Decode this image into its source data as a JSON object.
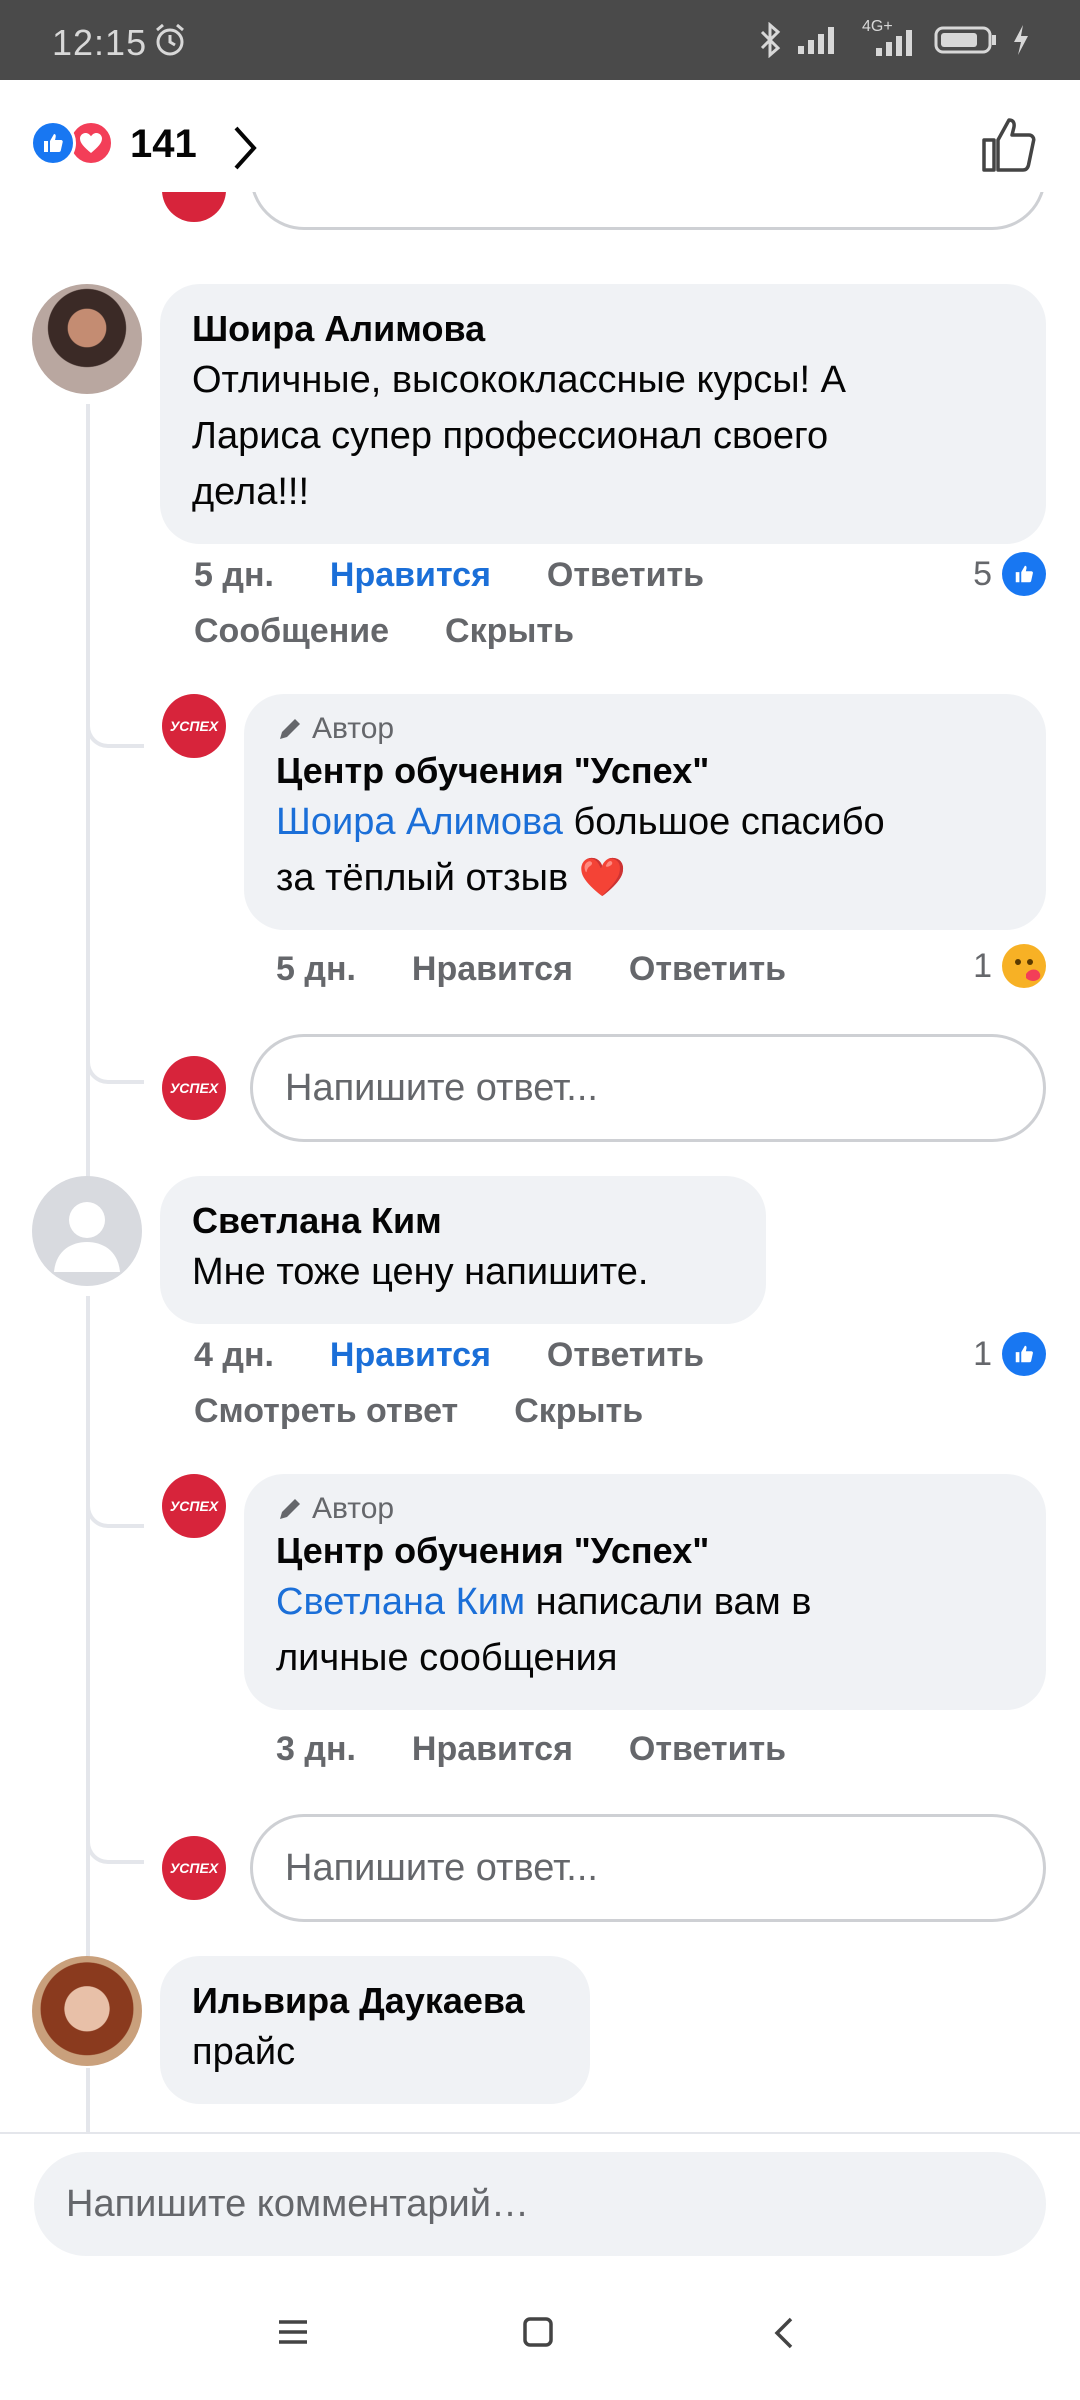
{
  "status": {
    "time": "12:15",
    "network": "4G+"
  },
  "top": {
    "reaction_count": "141"
  },
  "comments": [
    {
      "name": "Шоира Алимова",
      "text": "Отличные, высококлассные курсы! А Лариса супер профессионал своего дела!!!",
      "lines": [
        "Отличные, высококлассные курсы! А",
        "Лариса супер профессионал своего",
        "дела!!!"
      ],
      "time": "5 дн.",
      "like": "Нравится",
      "reply": "Ответить",
      "extra1": "Сообщение",
      "extra2": "Скрыть",
      "reactions": "5",
      "author_reply": {
        "badge": "Автор",
        "name": "Центр обучения \"Успех\"",
        "mention": "Шоира Алимова",
        "text_line1": " большое спасибо",
        "text_line2": "за тёплый отзыв ❤️",
        "time": "5 дн.",
        "like": "Нравится",
        "reply": "Ответить",
        "reactions": "1"
      },
      "reply_placeholder": "Напишите ответ..."
    },
    {
      "name": "Светлана Ким",
      "text": "Мне тоже цену напишите.",
      "time": "4 дн.",
      "like": "Нравится",
      "reply": "Ответить",
      "extra1": "Смотреть ответ",
      "extra2": "Скрыть",
      "reactions": "1",
      "author_reply": {
        "badge": "Автор",
        "name": "Центр обучения \"Успех\"",
        "mention": "Светлана Ким",
        "text_line1": " написали вам в",
        "text_line2": "личные сообщения",
        "time": "3 дн.",
        "like": "Нравится",
        "reply": "Ответить"
      },
      "reply_placeholder": "Напишите ответ..."
    },
    {
      "name": "Ильвира Даукаева",
      "text": "прайс"
    }
  ],
  "composer": {
    "placeholder": "Напишите комментарий…"
  },
  "logo_text": "УСПЕХ",
  "colors": {
    "accent": "#1877f2",
    "love": "#f33e58",
    "bubble": "#f0f2f5",
    "logo": "#d7243b"
  }
}
